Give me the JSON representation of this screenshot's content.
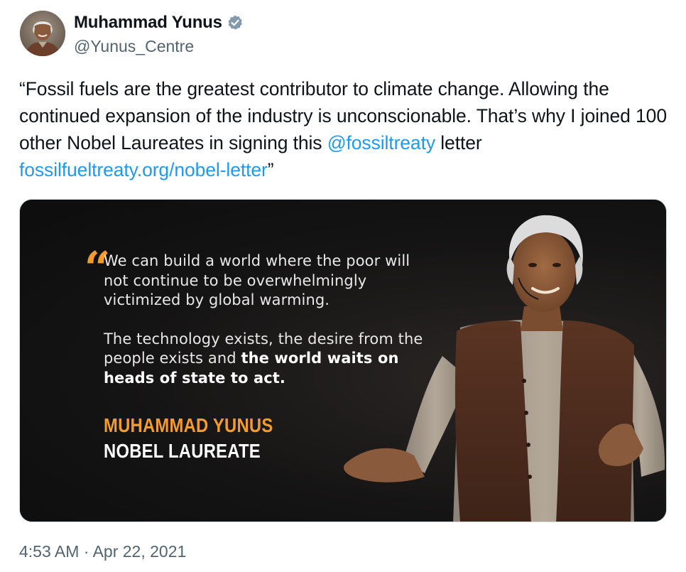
{
  "author": {
    "display_name": "Muhammad Yunus",
    "handle": "@Yunus_Centre",
    "verified": true
  },
  "tweet": {
    "text_part1": "“Fossil fuels are the greatest contributor to climate change. Allowing the continued expansion of the industry is unconscionable. That’s why I joined 100 other Nobel Laureates in signing this ",
    "mention": "@fossiltreaty",
    "text_part2": " letter ",
    "link": "fossilfueltreaty.org/nobel-letter",
    "text_part3": "”"
  },
  "media": {
    "quote_line1": "We can build a world where the poor will not continue to be overwhelmingly victimized by global warming.",
    "quote_line2_regular": "The technology exists, the desire from the people exists and ",
    "quote_line2_bold": "the world waits on heads of state to act.",
    "attribution_name": "MUHAMMAD YUNUS",
    "attribution_title": "NOBEL LAUREATE"
  },
  "timestamp": {
    "time": "4:53 AM",
    "separator": " · ",
    "date": "Apr 22, 2021"
  },
  "colors": {
    "link": "#1d9bf0",
    "verified": "#829aab",
    "accent_orange": "#f39c2d",
    "secondary_text": "#536471"
  }
}
